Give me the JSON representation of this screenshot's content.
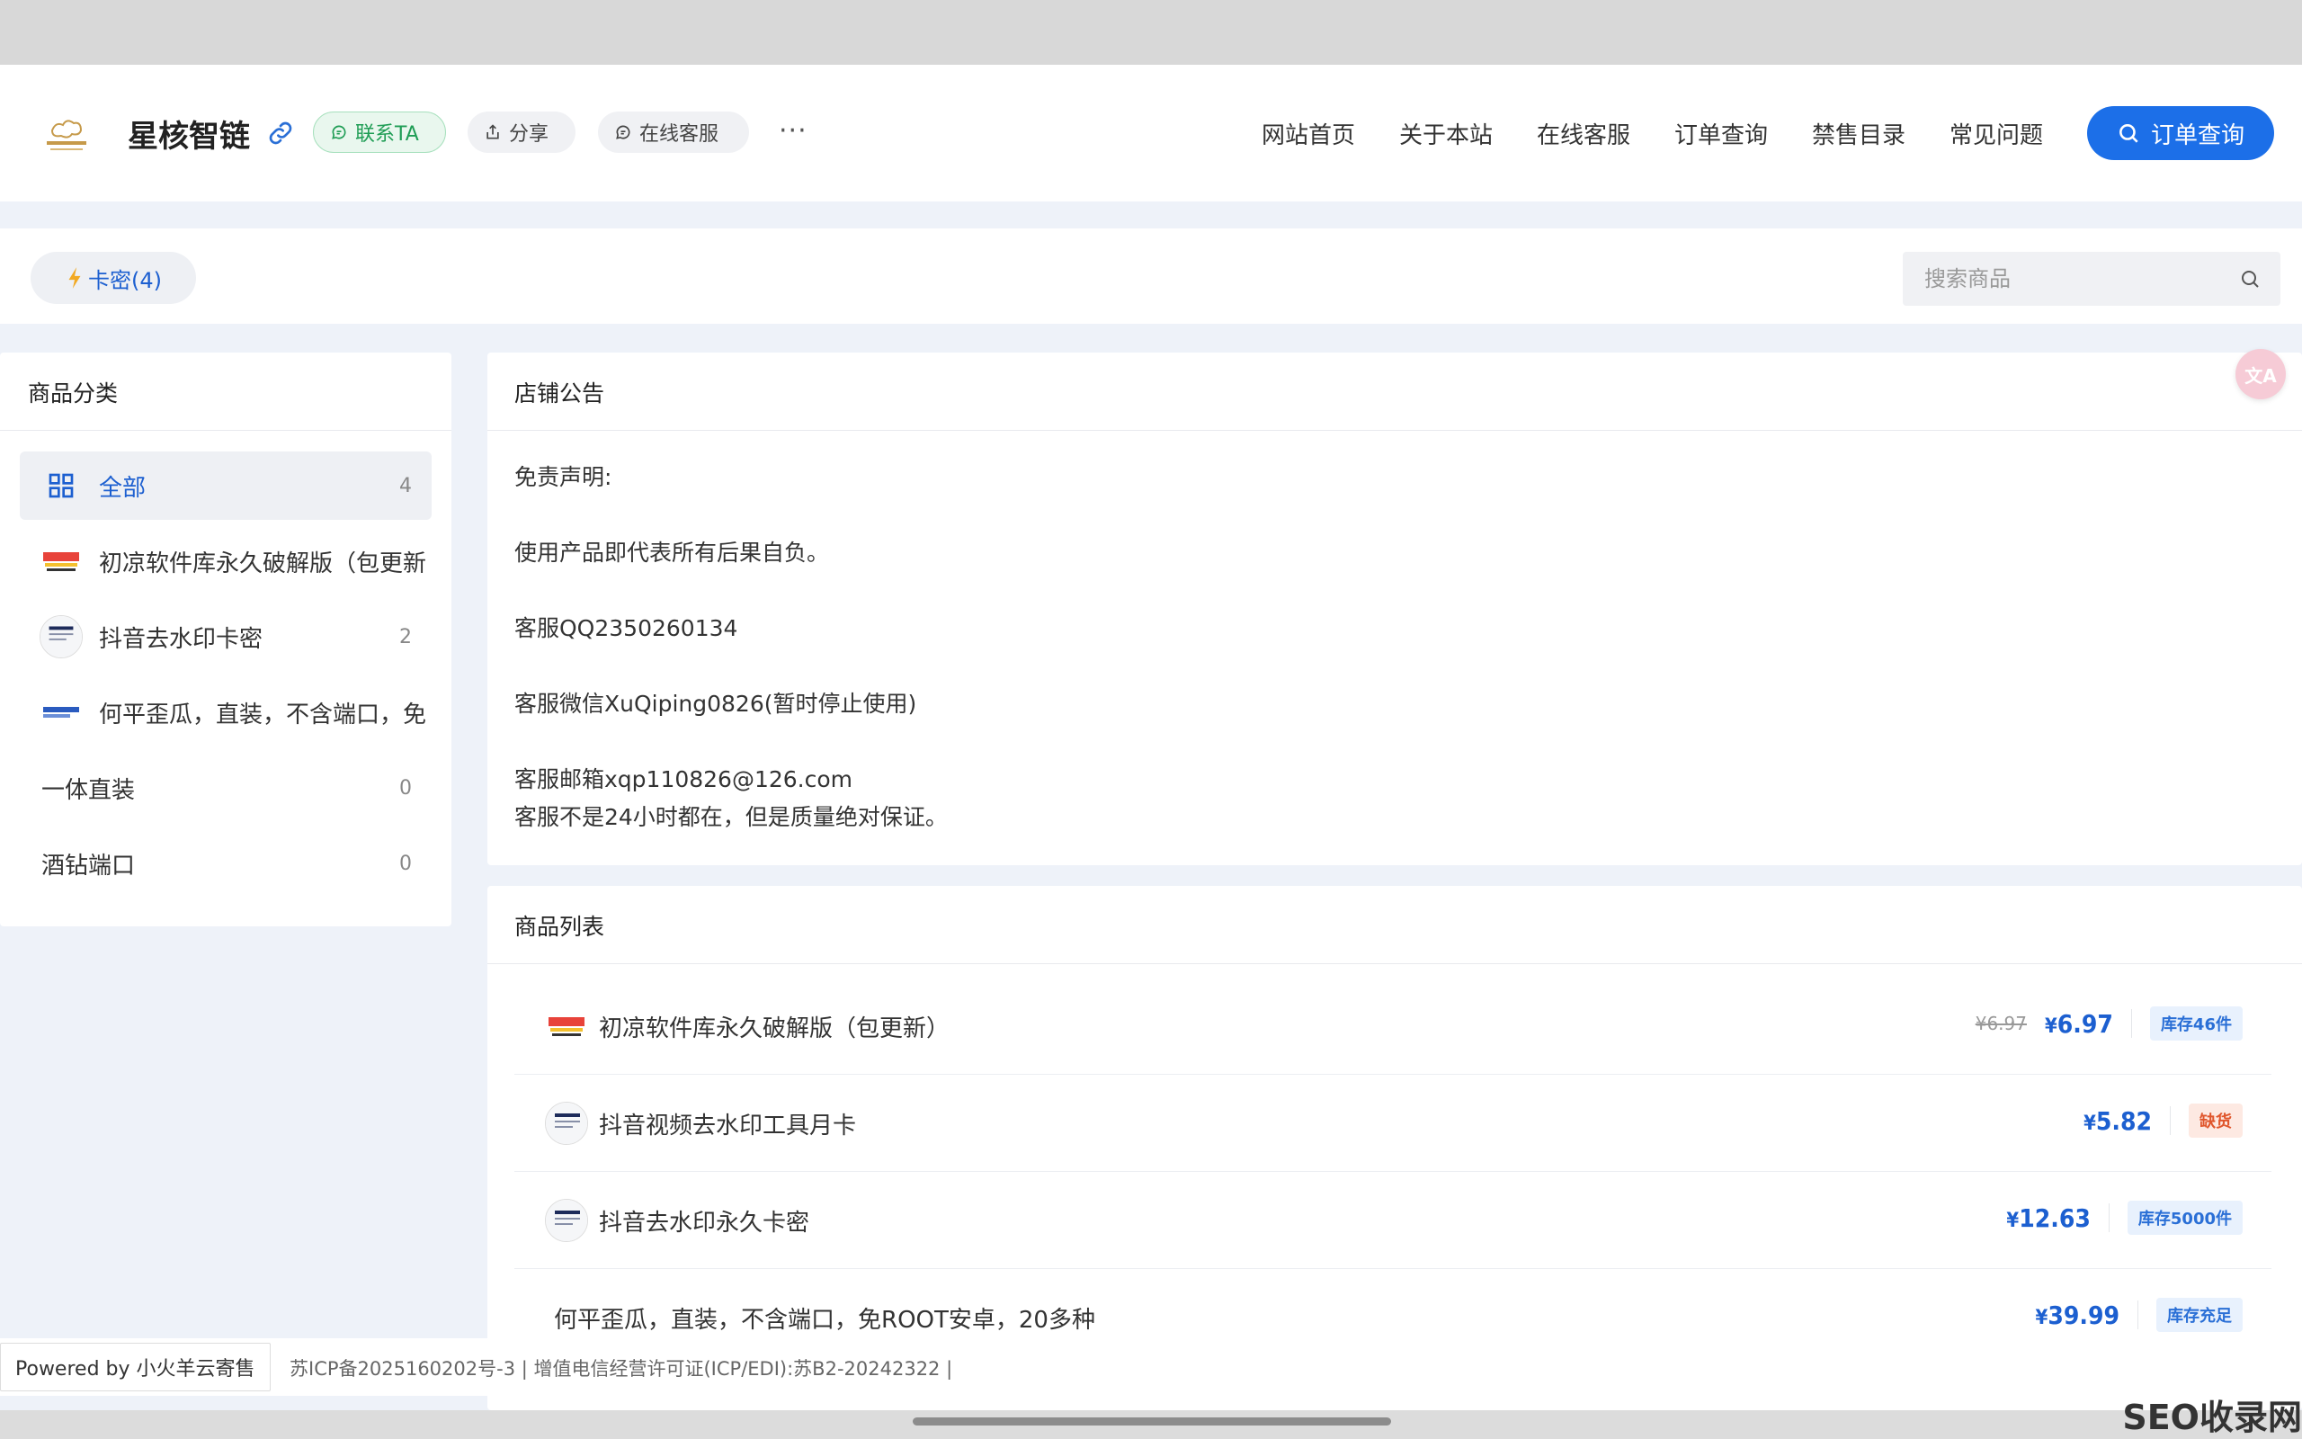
{
  "header": {
    "shop_name": "星核智链",
    "contact_label": "联系TA",
    "share_label": "分享",
    "service_label": "在线客服",
    "more_label": "···",
    "nav": [
      "网站首页",
      "关于本站",
      "在线客服",
      "订单查询",
      "禁售目录",
      "常见问题"
    ],
    "order_button": "订单查询"
  },
  "filter": {
    "tag_label": "卡密(4)",
    "search_placeholder": "搜索商品"
  },
  "sidebar": {
    "title": "商品分类",
    "items": [
      {
        "label": "全部",
        "count": "4"
      },
      {
        "label": "初凉软件库永久破解版（包更新",
        "count": ""
      },
      {
        "label": "抖音去水印卡密",
        "count": "2"
      },
      {
        "label": "何平歪瓜，直装，不含端口，免",
        "count": ""
      },
      {
        "label": "一体直装",
        "count": "0"
      },
      {
        "label": "酒钻端口",
        "count": "0"
      }
    ]
  },
  "notice": {
    "title": "店铺公告",
    "lines": [
      "免责声明:",
      "使用产品即代表所有后果自负。",
      "客服QQ2350260134",
      "客服微信XuQiping0826(暂时停止使用)",
      "客服邮箱xqp110826@126.com",
      "客服不是24小时都在，但是质量绝对保证。"
    ]
  },
  "products": {
    "title": "商品列表",
    "items": [
      {
        "name": "初凉软件库永久破解版（包更新）",
        "old_price": "¥6.97",
        "currency": "¥",
        "price": "6.97",
        "stock": "库存46件"
      },
      {
        "name": "抖音视频去水印工具月卡",
        "old_price": "",
        "currency": "¥",
        "price": "5.82",
        "stock": "缺货"
      },
      {
        "name": "抖音去水印永久卡密",
        "old_price": "",
        "currency": "¥",
        "price": "12.63",
        "stock": "库存5000件"
      },
      {
        "name": "何平歪瓜，直装，不含端口，免ROOT安卓，20多种",
        "old_price": "",
        "currency": "¥",
        "price": "39.99",
        "stock": "库存充足"
      }
    ]
  },
  "footer": {
    "powered": "Powered by 小火羊云寄售",
    "icp": "苏ICP备2025160202号-3 | 增值电信经营许可证(ICP/EDI):苏B2-20242322 |"
  },
  "watermark": "SEO收录网",
  "colors": {
    "accent": "#1c6fe8",
    "contact_green": "#1f9d55",
    "out_of_stock": "#e0572d"
  }
}
